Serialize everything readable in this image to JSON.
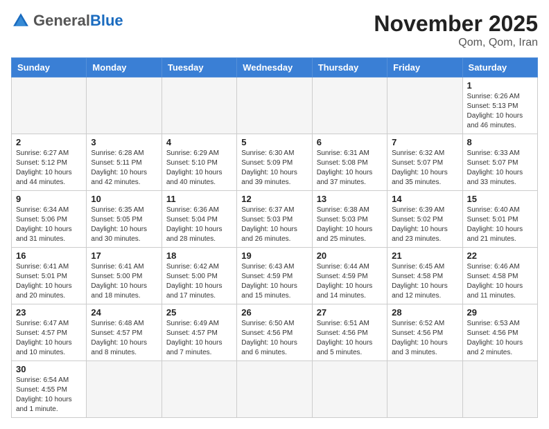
{
  "logo": {
    "general": "General",
    "blue": "Blue"
  },
  "title": "November 2025",
  "subtitle": "Qom, Qom, Iran",
  "weekdays": [
    "Sunday",
    "Monday",
    "Tuesday",
    "Wednesday",
    "Thursday",
    "Friday",
    "Saturday"
  ],
  "weeks": [
    [
      {
        "day": "",
        "info": ""
      },
      {
        "day": "",
        "info": ""
      },
      {
        "day": "",
        "info": ""
      },
      {
        "day": "",
        "info": ""
      },
      {
        "day": "",
        "info": ""
      },
      {
        "day": "",
        "info": ""
      },
      {
        "day": "1",
        "info": "Sunrise: 6:26 AM\nSunset: 5:13 PM\nDaylight: 10 hours\nand 46 minutes."
      }
    ],
    [
      {
        "day": "2",
        "info": "Sunrise: 6:27 AM\nSunset: 5:12 PM\nDaylight: 10 hours\nand 44 minutes."
      },
      {
        "day": "3",
        "info": "Sunrise: 6:28 AM\nSunset: 5:11 PM\nDaylight: 10 hours\nand 42 minutes."
      },
      {
        "day": "4",
        "info": "Sunrise: 6:29 AM\nSunset: 5:10 PM\nDaylight: 10 hours\nand 40 minutes."
      },
      {
        "day": "5",
        "info": "Sunrise: 6:30 AM\nSunset: 5:09 PM\nDaylight: 10 hours\nand 39 minutes."
      },
      {
        "day": "6",
        "info": "Sunrise: 6:31 AM\nSunset: 5:08 PM\nDaylight: 10 hours\nand 37 minutes."
      },
      {
        "day": "7",
        "info": "Sunrise: 6:32 AM\nSunset: 5:07 PM\nDaylight: 10 hours\nand 35 minutes."
      },
      {
        "day": "8",
        "info": "Sunrise: 6:33 AM\nSunset: 5:07 PM\nDaylight: 10 hours\nand 33 minutes."
      }
    ],
    [
      {
        "day": "9",
        "info": "Sunrise: 6:34 AM\nSunset: 5:06 PM\nDaylight: 10 hours\nand 31 minutes."
      },
      {
        "day": "10",
        "info": "Sunrise: 6:35 AM\nSunset: 5:05 PM\nDaylight: 10 hours\nand 30 minutes."
      },
      {
        "day": "11",
        "info": "Sunrise: 6:36 AM\nSunset: 5:04 PM\nDaylight: 10 hours\nand 28 minutes."
      },
      {
        "day": "12",
        "info": "Sunrise: 6:37 AM\nSunset: 5:03 PM\nDaylight: 10 hours\nand 26 minutes."
      },
      {
        "day": "13",
        "info": "Sunrise: 6:38 AM\nSunset: 5:03 PM\nDaylight: 10 hours\nand 25 minutes."
      },
      {
        "day": "14",
        "info": "Sunrise: 6:39 AM\nSunset: 5:02 PM\nDaylight: 10 hours\nand 23 minutes."
      },
      {
        "day": "15",
        "info": "Sunrise: 6:40 AM\nSunset: 5:01 PM\nDaylight: 10 hours\nand 21 minutes."
      }
    ],
    [
      {
        "day": "16",
        "info": "Sunrise: 6:41 AM\nSunset: 5:01 PM\nDaylight: 10 hours\nand 20 minutes."
      },
      {
        "day": "17",
        "info": "Sunrise: 6:41 AM\nSunset: 5:00 PM\nDaylight: 10 hours\nand 18 minutes."
      },
      {
        "day": "18",
        "info": "Sunrise: 6:42 AM\nSunset: 5:00 PM\nDaylight: 10 hours\nand 17 minutes."
      },
      {
        "day": "19",
        "info": "Sunrise: 6:43 AM\nSunset: 4:59 PM\nDaylight: 10 hours\nand 15 minutes."
      },
      {
        "day": "20",
        "info": "Sunrise: 6:44 AM\nSunset: 4:59 PM\nDaylight: 10 hours\nand 14 minutes."
      },
      {
        "day": "21",
        "info": "Sunrise: 6:45 AM\nSunset: 4:58 PM\nDaylight: 10 hours\nand 12 minutes."
      },
      {
        "day": "22",
        "info": "Sunrise: 6:46 AM\nSunset: 4:58 PM\nDaylight: 10 hours\nand 11 minutes."
      }
    ],
    [
      {
        "day": "23",
        "info": "Sunrise: 6:47 AM\nSunset: 4:57 PM\nDaylight: 10 hours\nand 10 minutes."
      },
      {
        "day": "24",
        "info": "Sunrise: 6:48 AM\nSunset: 4:57 PM\nDaylight: 10 hours\nand 8 minutes."
      },
      {
        "day": "25",
        "info": "Sunrise: 6:49 AM\nSunset: 4:57 PM\nDaylight: 10 hours\nand 7 minutes."
      },
      {
        "day": "26",
        "info": "Sunrise: 6:50 AM\nSunset: 4:56 PM\nDaylight: 10 hours\nand 6 minutes."
      },
      {
        "day": "27",
        "info": "Sunrise: 6:51 AM\nSunset: 4:56 PM\nDaylight: 10 hours\nand 5 minutes."
      },
      {
        "day": "28",
        "info": "Sunrise: 6:52 AM\nSunset: 4:56 PM\nDaylight: 10 hours\nand 3 minutes."
      },
      {
        "day": "29",
        "info": "Sunrise: 6:53 AM\nSunset: 4:56 PM\nDaylight: 10 hours\nand 2 minutes."
      }
    ],
    [
      {
        "day": "30",
        "info": "Sunrise: 6:54 AM\nSunset: 4:55 PM\nDaylight: 10 hours\nand 1 minute."
      },
      {
        "day": "",
        "info": ""
      },
      {
        "day": "",
        "info": ""
      },
      {
        "day": "",
        "info": ""
      },
      {
        "day": "",
        "info": ""
      },
      {
        "day": "",
        "info": ""
      },
      {
        "day": "",
        "info": ""
      }
    ]
  ]
}
